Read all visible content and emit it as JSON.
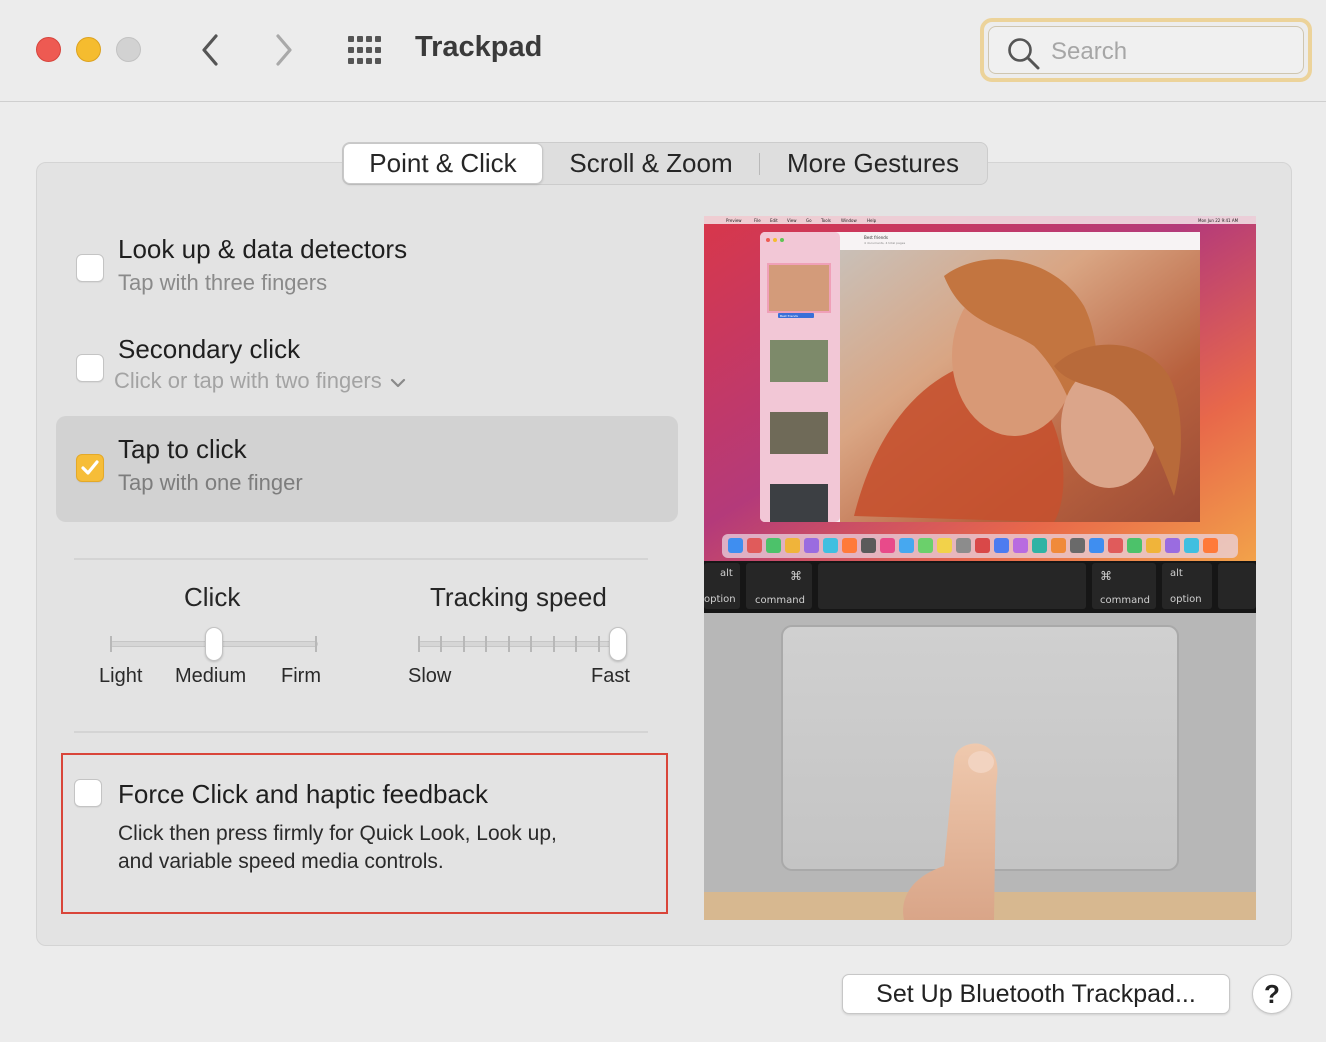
{
  "window": {
    "title": "Trackpad"
  },
  "search": {
    "placeholder": "Search",
    "value": ""
  },
  "tabs": [
    {
      "label": "Point & Click",
      "active": true
    },
    {
      "label": "Scroll & Zoom",
      "active": false
    },
    {
      "label": "More Gestures",
      "active": false
    }
  ],
  "options": [
    {
      "title": "Look up & data detectors",
      "subtitle": "Tap with three fingers",
      "checked": false
    },
    {
      "title": "Secondary click",
      "subtitle": "Click or tap with two fingers",
      "checked": false,
      "has_dropdown": true
    },
    {
      "title": "Tap to click",
      "subtitle": "Tap with one finger",
      "checked": true
    }
  ],
  "sliders": {
    "click": {
      "title": "Click",
      "labels": [
        "Light",
        "Medium",
        "Firm"
      ],
      "value": "Medium"
    },
    "tracking": {
      "title": "Tracking speed",
      "min_label": "Slow",
      "max_label": "Fast",
      "level": 1.0
    }
  },
  "force_click": {
    "title": "Force Click and haptic feedback",
    "description_line1": "Click then press firmly for Quick Look, Look up,",
    "description_line2": "and variable speed media controls.",
    "checked": false
  },
  "preview": {
    "menubar_items": [
      "Preview",
      "File",
      "Edit",
      "View",
      "Go",
      "Tools",
      "Window",
      "Help"
    ],
    "menubar_time": "Mon Jun 22  9:41 AM",
    "doc_title": "Best friends",
    "doc_subtitle": "4 documents, 4 total pages",
    "thumb_caption": "Best friends",
    "keys": {
      "alt": "alt",
      "option": "option",
      "command": "command",
      "cmd_symbol": "⌘"
    }
  },
  "footer": {
    "setup_button": "Set Up Bluetooth Trackpad...",
    "help_label": "?"
  },
  "colors": {
    "accent": "#f6bd38",
    "highlight_border": "#d9453a",
    "search_focus": "#ecd39a"
  }
}
